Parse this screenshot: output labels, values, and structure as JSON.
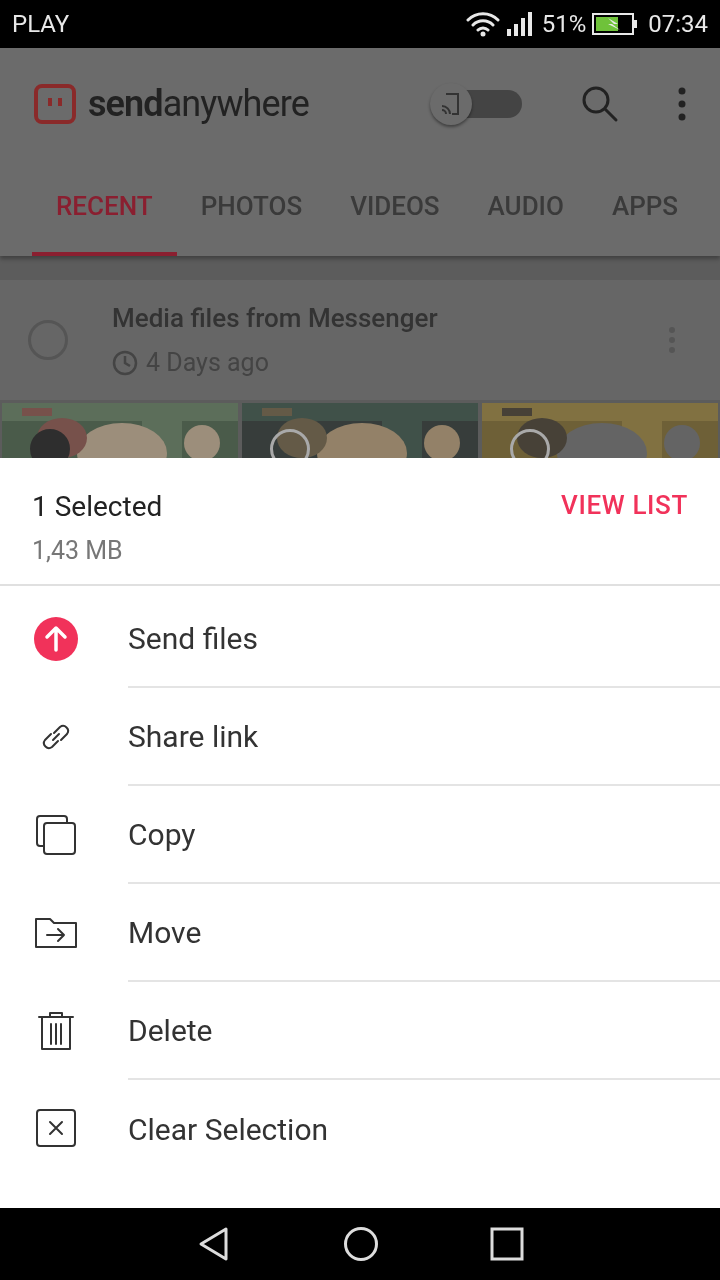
{
  "status_bar": {
    "carrier": "PLAY",
    "battery": "51%",
    "time": "07:34"
  },
  "app_bar": {
    "logo_bold": "send",
    "logo_light": "anywhere",
    "toggle": {
      "on": false
    }
  },
  "tabs": [
    {
      "label": "RECENT",
      "selected": true
    },
    {
      "label": "PHOTOS",
      "selected": false
    },
    {
      "label": "VIDEOS",
      "selected": false
    },
    {
      "label": "AUDIO",
      "selected": false
    },
    {
      "label": "APPS",
      "selected": false
    }
  ],
  "group": {
    "title": "Media files from Messenger",
    "time": "4 Days ago",
    "selected": false
  },
  "thumbnails": [
    {
      "kind": "picture",
      "selected": true
    },
    {
      "kind": "picture",
      "selected": false
    },
    {
      "kind": "picture",
      "selected": false
    }
  ],
  "sheet": {
    "count": "1 Selected",
    "size": "1,43 MB",
    "view_list": "VIEW LIST",
    "actions": [
      {
        "kind": "send",
        "label": "Send files"
      },
      {
        "kind": "link",
        "label": "Share link"
      },
      {
        "kind": "copy",
        "label": "Copy"
      },
      {
        "kind": "move",
        "label": "Move"
      },
      {
        "kind": "delete",
        "label": "Delete"
      },
      {
        "kind": "clear",
        "label": "Clear Selection"
      }
    ]
  }
}
